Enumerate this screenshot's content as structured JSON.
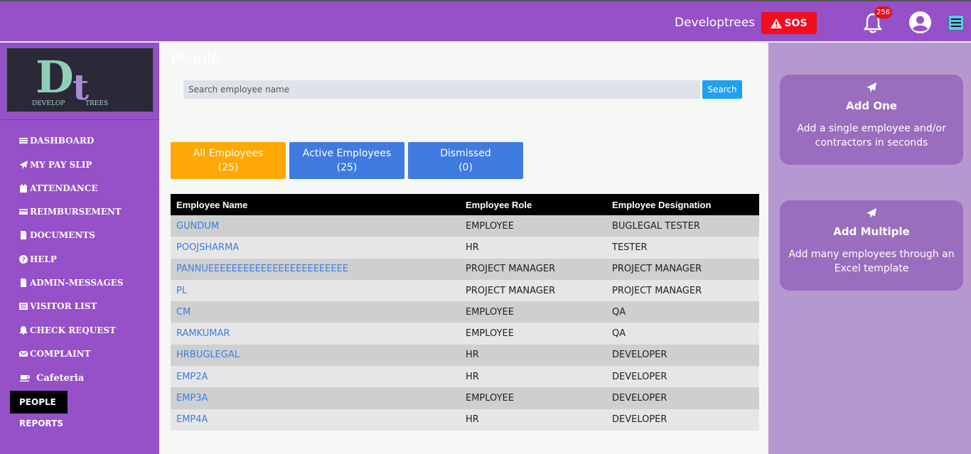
{
  "header": {
    "brand": "Developtrees",
    "sos_label": "SOS",
    "notification_count": "256"
  },
  "logo": {
    "text": "DEVELOP TREES",
    "letters": "Dt"
  },
  "sidebar": {
    "items": [
      {
        "label": "DASHBOARD",
        "icon": "bars-icon"
      },
      {
        "label": "MY PAY SLIP",
        "icon": "paper-plane-icon"
      },
      {
        "label": "ATTENDANCE",
        "icon": "calendar-icon"
      },
      {
        "label": "REIMBURSEMENT",
        "icon": "credit-card-icon"
      },
      {
        "label": "DOCUMENTS",
        "icon": "file-icon"
      },
      {
        "label": "HELP",
        "icon": "question-circle-icon"
      },
      {
        "label": "ADMIN-MESSAGES",
        "icon": "file-icon"
      },
      {
        "label": "VISITOR LIST",
        "icon": "list-icon"
      },
      {
        "label": "CHECK REQUEST",
        "icon": "bell-icon"
      },
      {
        "label": "COMPLAINT",
        "icon": "envelope-icon"
      },
      {
        "label": "Cafeteria",
        "icon": "coffee-icon"
      }
    ],
    "active": "PEOPLE",
    "reports": "REPORTS"
  },
  "main": {
    "title": "People",
    "search": {
      "placeholder": "Search employee name",
      "button": "Search"
    },
    "tabs": [
      {
        "label": "All Employees",
        "count": "(25)"
      },
      {
        "label": "Active Employees",
        "count": "(25)"
      },
      {
        "label": "Dismissed",
        "count": "(0)"
      }
    ],
    "table": {
      "headers": [
        "Employee Name",
        "Employee Role",
        "Employee Designation"
      ],
      "rows": [
        [
          "GUNDUM",
          "EMPLOYEE",
          "BUGLEGAL TESTER"
        ],
        [
          "POOJSHARMA",
          "HR",
          "TESTER"
        ],
        [
          "PANNUEEEEEEEEEEEEEEEEEEEEEEEE",
          "PROJECT MANAGER",
          "PROJECT MANAGER"
        ],
        [
          "PL",
          "PROJECT MANAGER",
          "PROJECT MANAGER"
        ],
        [
          "CM",
          "EMPLOYEE",
          "QA"
        ],
        [
          "RAMKUMAR",
          "EMPLOYEE",
          "QA"
        ],
        [
          "HRBUGLEGAL",
          "HR",
          "DEVELOPER"
        ],
        [
          "EMP2A",
          "HR",
          "DEVELOPER"
        ],
        [
          "EMP3A",
          "EMPLOYEE",
          "DEVELOPER"
        ],
        [
          "EMP4A",
          "HR",
          "DEVELOPER"
        ]
      ]
    }
  },
  "right_panel": {
    "cards": [
      {
        "title": "Add One",
        "desc": "Add a single employee and/or contractors in seconds"
      },
      {
        "title": "Add Multiple",
        "desc": "Add many employees through an Excel template"
      }
    ]
  },
  "colors": {
    "purple": "#9650c8",
    "orange": "#ffa704",
    "blue": "#3f7be0",
    "sos": "#f20d1f"
  }
}
